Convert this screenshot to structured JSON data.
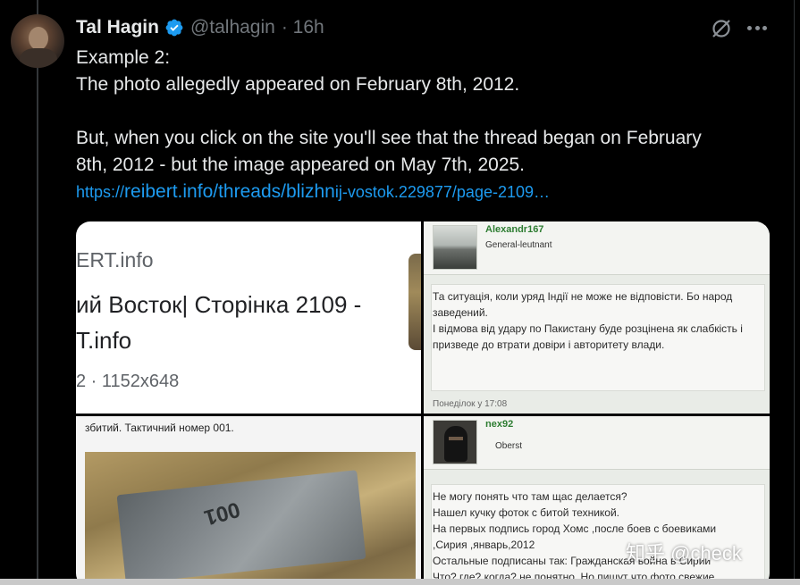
{
  "tweet": {
    "author_name": "Tal Hagin",
    "author_handle": "@talhagin",
    "time": "· 16h",
    "lines": [
      "Example 2:",
      "The photo allegedly appeared on February 8th, 2012.",
      "But, when you click on the site you'll see that the thread began on February",
      "8th, 2012 - but the image appeared on May 7th, 2025."
    ],
    "link_parts": [
      "https://",
      "reibert.info/threads/blizhn",
      "ij-vostok.229877/page-2109…"
    ]
  },
  "media": {
    "google_result": {
      "site": "ERT.info",
      "title_line1": "ий Восток| Сторінка 2109 -",
      "title_line2": "T.info",
      "meta": "2 · 1152x648"
    },
    "post1": {
      "user": "Alexandr167",
      "rank": "General-leutnant",
      "lines": [
        "Та ситуація, коли уряд Індії не може не відповісти. Бо народ",
        "заведений.",
        "І відмова від удару по Пакистану буде розцінена як слабкість і",
        "призведе до втрати довіри і авторитету влади."
      ],
      "time": "Понеділок у 17:08"
    },
    "caption": "збитий. Тактичний номер 001.",
    "post2": {
      "user": "nex92",
      "rank": "Oberst",
      "lines": [
        "Не могу понять что там щас делается?",
        "Нашел кучку фоток с битой техникой.",
        "На первых подпись город Хомс ,после боев с боевиками",
        ",Сирия ,январь,2012",
        "Остальные подписаны так: Гражданская война в Сирии",
        "Что? где? когда? не понятно. Но пишут что фото свежие."
      ]
    }
  },
  "watermark": "知乎 @check",
  "colors": {
    "link": "#1d9bf0",
    "verified": "#1d9bf0",
    "background": "#000000"
  }
}
